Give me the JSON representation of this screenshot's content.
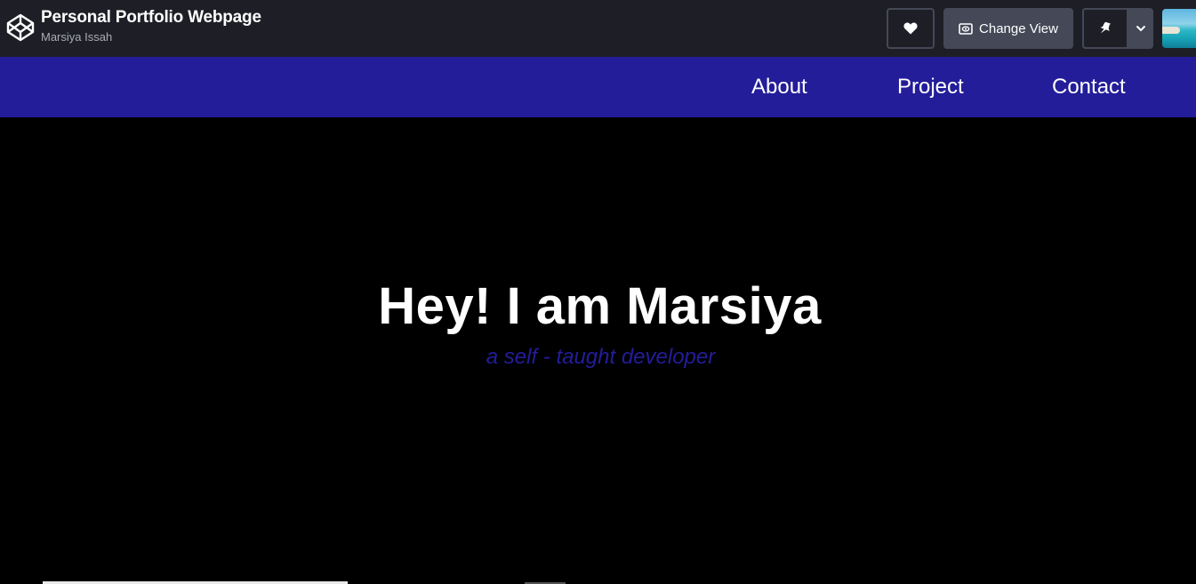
{
  "header": {
    "pen_title": "Personal Portfolio Webpage",
    "author": "Marsiya Issah",
    "icons": {
      "logo": "codepen-logo-icon",
      "heart": "heart-icon",
      "view": "eye-icon",
      "pin": "pin-icon",
      "menu": "chevron-down-icon"
    },
    "change_view_label": "Change View"
  },
  "nav": {
    "items": [
      {
        "label": "About"
      },
      {
        "label": "Project"
      },
      {
        "label": "Contact"
      }
    ]
  },
  "hero": {
    "title": "Hey! I am Marsiya",
    "subtitle": "a self - taught developer"
  },
  "colors": {
    "topbar_bg": "#1e1f26",
    "button_bg": "#444857",
    "nav_bg": "#231d9a",
    "hero_bg": "#000000",
    "subtitle_color": "#231d9a"
  }
}
